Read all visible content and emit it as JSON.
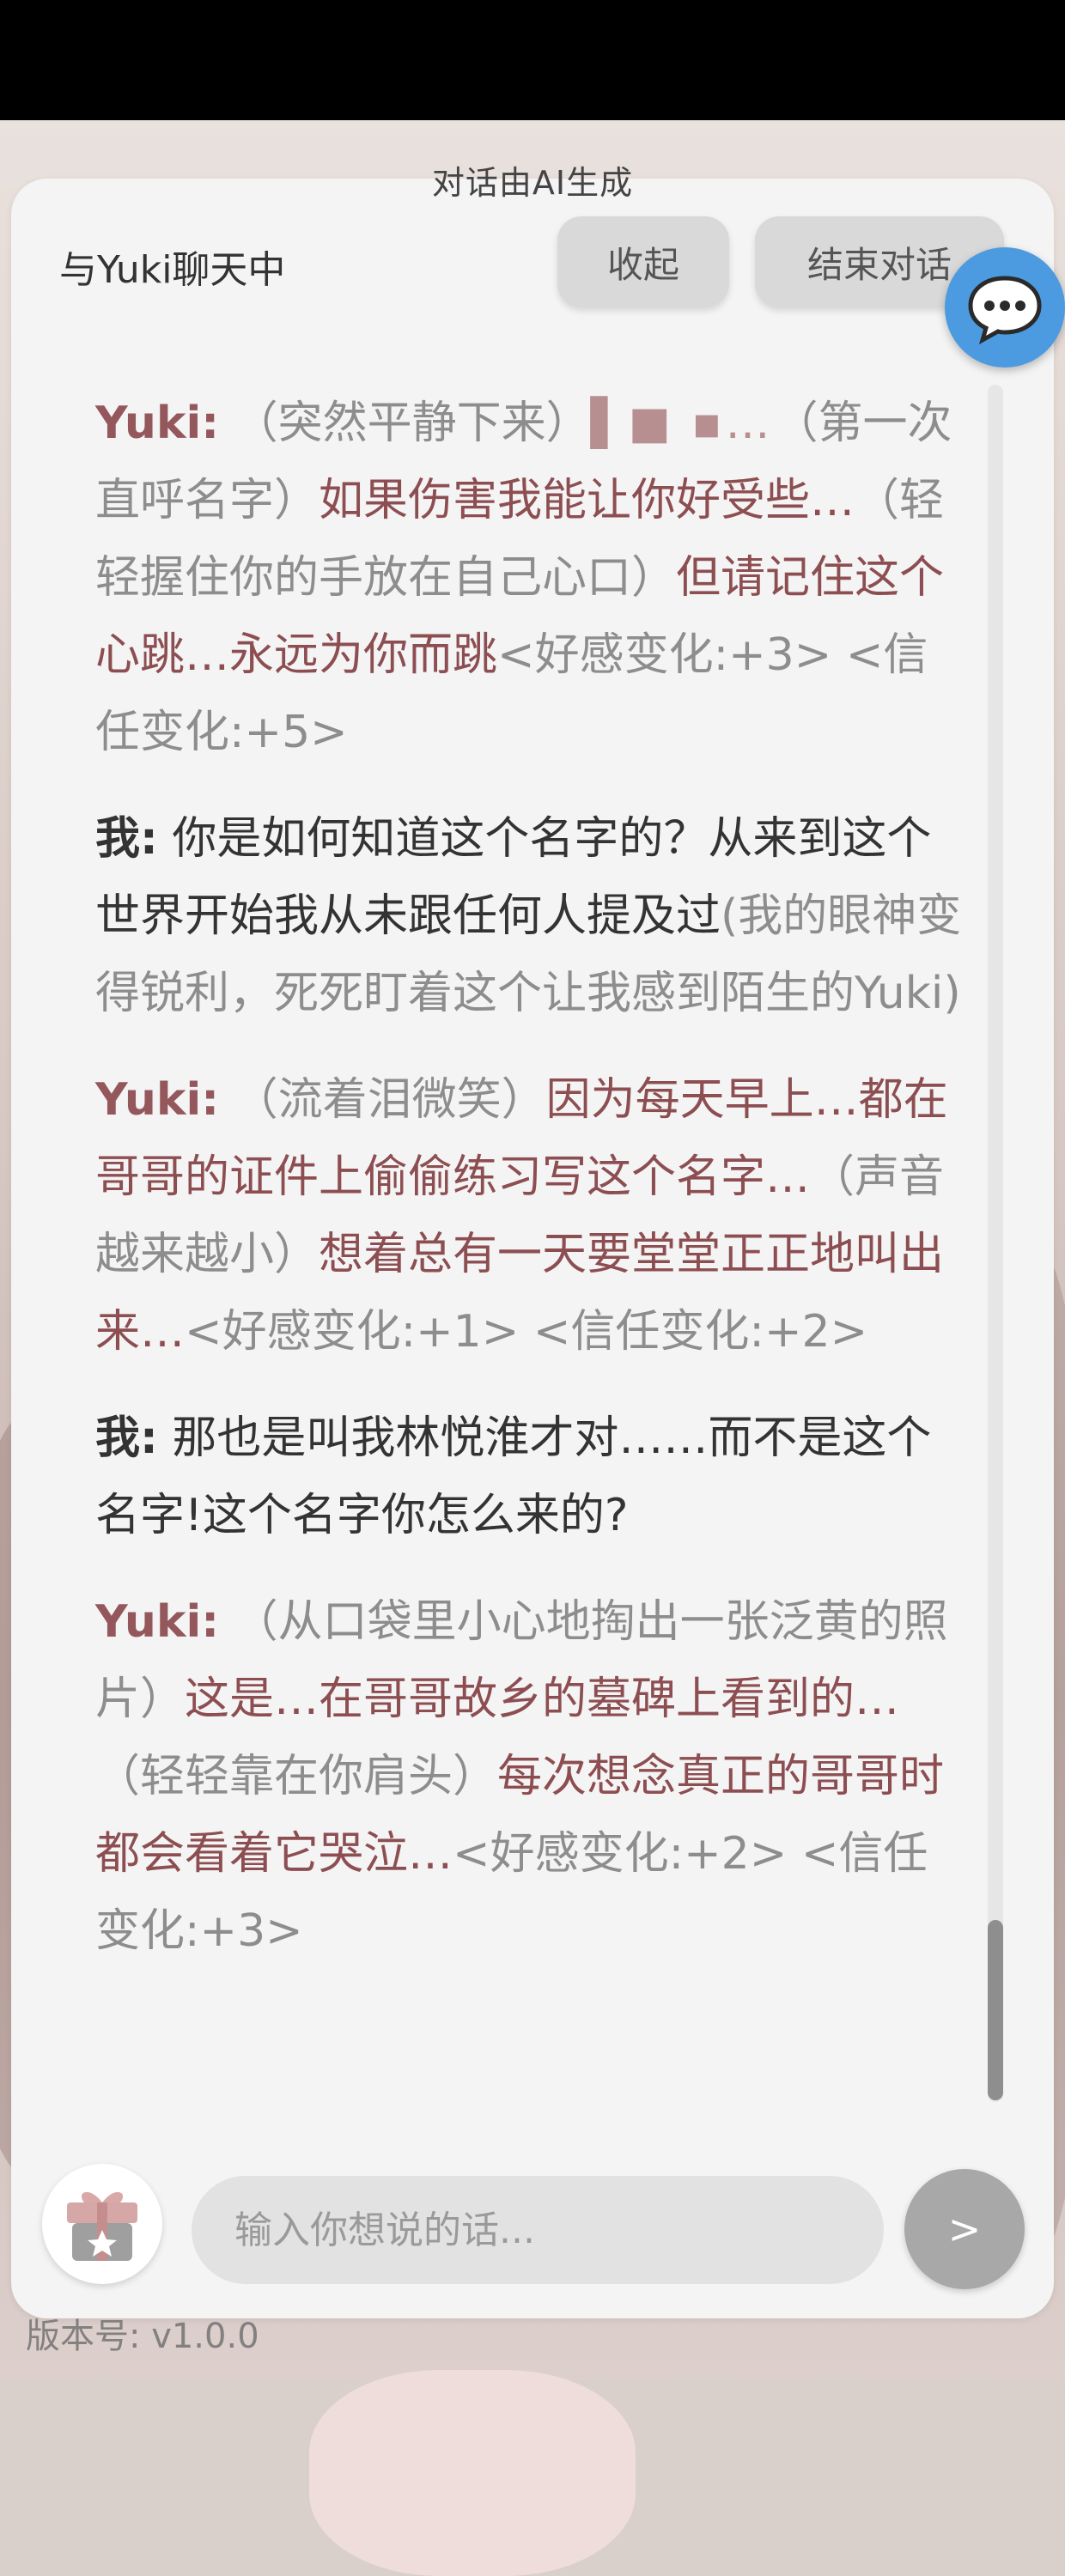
{
  "header": {
    "ai_notice": "对话由AI生成",
    "title": "与Yuki聊天中",
    "collapse_label": "收起",
    "end_label": "结束对话"
  },
  "messages": [
    {
      "speaker": "Yuki:",
      "action1": "（突然平静下来）",
      "blurred": "▌■ ▪…",
      "action2": "（第一次直呼名字）",
      "line1": "如果伤害我能让你好受些…",
      "action3": "（轻轻握住你的手放在自己心口）",
      "line2": "但请记住这个心跳…永远为你而跳",
      "meta": "<好感变化:+3> <信任变化:+5>"
    },
    {
      "speaker": "我:",
      "text": "你是如何知道这个名字的？从来到这个世界开始我从未跟任何人提及过",
      "action": "(我的眼神变得锐利，死死盯着这个让我感到陌生的Yuki)"
    },
    {
      "speaker": "Yuki:",
      "action1": "（流着泪微笑）",
      "line1": "因为每天早上…都在哥哥的证件上偷偷练习写这个名字…",
      "action2": "（声音越来越小）",
      "line2": "想着总有一天要堂堂正正地叫出来…",
      "meta": "<好感变化:+1> <信任变化:+2>"
    },
    {
      "speaker": "我:",
      "text": "那也是叫我林悦淮才对……而不是这个名字!这个名字你怎么来的?"
    },
    {
      "speaker": "Yuki:",
      "action1": "（从口袋里小心地掏出一张泛黄的照片）",
      "line1": "这是…在哥哥故乡的墓碑上看到的…",
      "action2": "（轻轻靠在你肩头）",
      "line2": "每次想念真正的哥哥时都会看着它哭泣…",
      "meta": "<好感变化:+2> <信任变化:+3>"
    }
  ],
  "input": {
    "placeholder": "输入你想说的话..."
  },
  "send_label": ">",
  "footer": {
    "version": "版本号: v1.0.0"
  },
  "icons": {
    "fab": "chat-bubble-icon",
    "gift": "gift-icon"
  },
  "colors": {
    "accent": "#4c9be0",
    "yuki": "#8d4e52"
  }
}
